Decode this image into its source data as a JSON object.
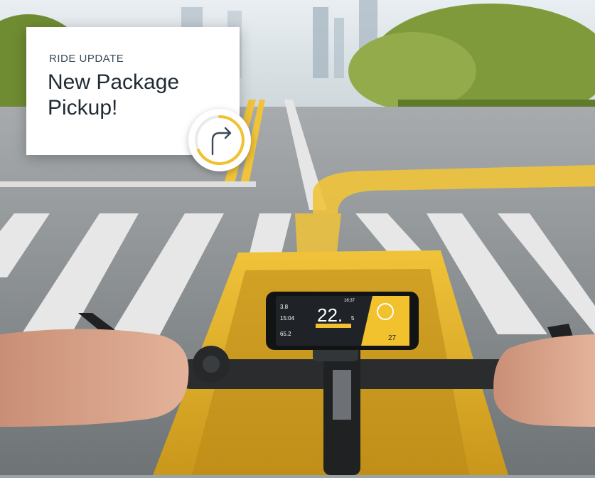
{
  "notification": {
    "label": "RIDE UPDATE",
    "title_line1": "New Package",
    "title_line2": "Pickup!",
    "icon": "turn-right-icon",
    "accent_color": "#f2c12e"
  },
  "phone_display": {
    "time": "16:37",
    "stat1_value": "3.8",
    "stat2_value": "15:04",
    "stat3_value": "65.2",
    "speed": "22.",
    "speed_decimal": "5",
    "nav_value": "27",
    "nav_icon": "turn-right-icon"
  }
}
